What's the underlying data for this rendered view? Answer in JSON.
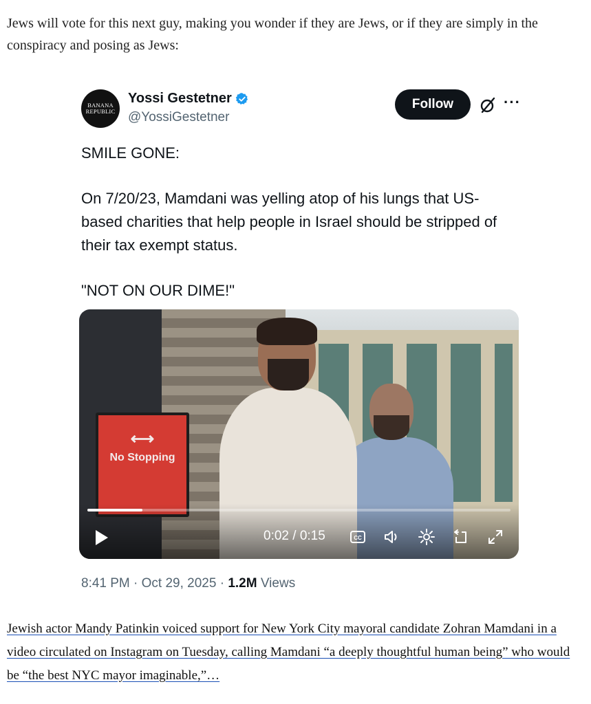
{
  "intro_text": "Jews will vote for this next guy, making you wonder if they are Jews, or if they are simply in the conspiracy and posing as Jews:",
  "tweet": {
    "avatar_text": [
      "BANANA",
      "REPUBLIC"
    ],
    "display_name": "Yossi Gestetner",
    "handle": "@YossiGestetner",
    "follow_label": "Follow",
    "paragraphs": [
      "SMILE GONE:",
      "On 7/20/23, Mamdani was yelling atop of his lungs that US-based charities that help people in Israel should be stripped of their tax exempt status.",
      "\"NOT ON OUR DIME!\""
    ],
    "video": {
      "sign_text": "No Stopping",
      "sign_arrow": "⟷",
      "timecode": "0:02 / 0:15",
      "progress": 0.13
    },
    "meta": {
      "time_date": "8:41 PM · Oct 29, 2025 · ",
      "views_count": "1.2M",
      "views_label": " Views"
    }
  },
  "article_link": "Jewish actor Mandy Patinkin voiced support for New York City mayoral candidate Zohran Mamdani in a video circulated on Instagram on Tuesday, calling Mamdani “a deeply thoughtful human being” who would be “the best NYC mayor imaginable,”…",
  "colors": {
    "verified_blue": "#1d9bf0",
    "follow_bg": "#0f1419",
    "muted_text": "#536471"
  },
  "icons": [
    "verified-badge-icon",
    "grok-icon",
    "more-icon",
    "play-icon",
    "captions-icon",
    "volume-icon",
    "settings-icon",
    "share-icon",
    "fullscreen-icon"
  ]
}
